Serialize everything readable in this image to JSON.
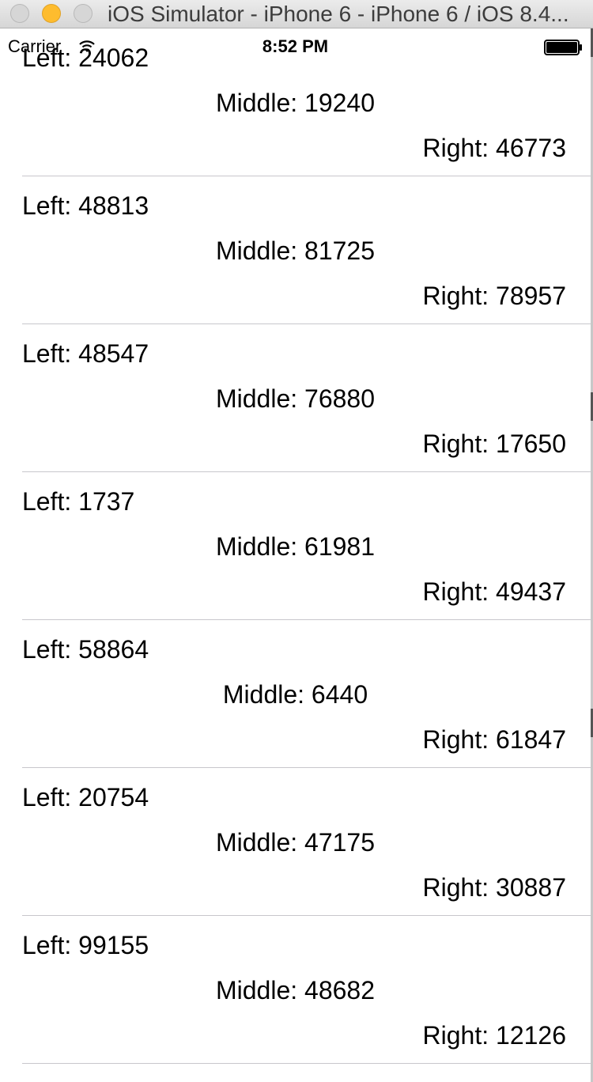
{
  "window": {
    "title": "iOS Simulator - iPhone 6 - iPhone 6 / iOS 8.4..."
  },
  "status_bar": {
    "carrier": "Carrier",
    "time": "8:52 PM",
    "wifi_icon": "wifi-icon",
    "battery_icon": "battery-icon"
  },
  "rows": [
    {
      "left": "Left: 24062",
      "middle": "Middle: 19240",
      "right": "Right: 46773"
    },
    {
      "left": "Left: 48813",
      "middle": "Middle: 81725",
      "right": "Right: 78957"
    },
    {
      "left": "Left: 48547",
      "middle": "Middle: 76880",
      "right": "Right: 17650"
    },
    {
      "left": "Left: 1737",
      "middle": "Middle: 61981",
      "right": "Right: 49437"
    },
    {
      "left": "Left: 58864",
      "middle": "Middle: 6440",
      "right": "Right: 61847"
    },
    {
      "left": "Left: 20754",
      "middle": "Middle: 47175",
      "right": "Right: 30887"
    },
    {
      "left": "Left: 99155",
      "middle": "Middle: 48682",
      "right": "Right: 12126"
    }
  ]
}
